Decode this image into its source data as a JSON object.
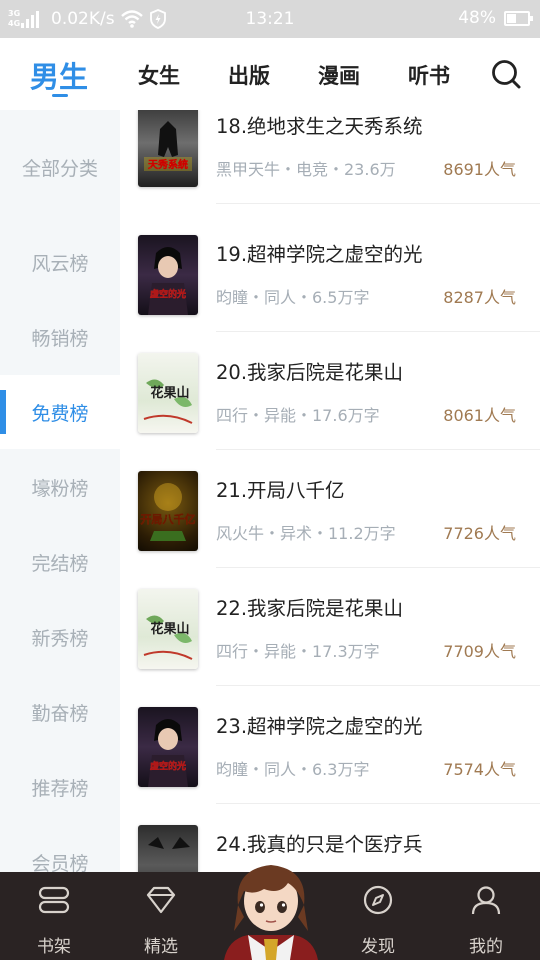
{
  "status_bar": {
    "network_type_a": "3G",
    "network_type_b": "4G",
    "speed": "0.02K/s",
    "time": "13:21",
    "battery": "48%",
    "icons": [
      "signal-icon",
      "wifi-icon",
      "shield-icon",
      "battery-icon"
    ]
  },
  "top_tabs": [
    {
      "label": "男生",
      "active": true
    },
    {
      "label": "女生",
      "active": false
    },
    {
      "label": "出版",
      "active": false
    },
    {
      "label": "漫画",
      "active": false
    },
    {
      "label": "听书",
      "active": false
    }
  ],
  "search_icon": "search-icon",
  "sidebar": {
    "items": [
      {
        "label": "全部分类",
        "active": false
      },
      {
        "label": "风云榜",
        "active": false
      },
      {
        "label": "畅销榜",
        "active": false
      },
      {
        "label": "免费榜",
        "active": true
      },
      {
        "label": "壕粉榜",
        "active": false
      },
      {
        "label": "完结榜",
        "active": false
      },
      {
        "label": "新秀榜",
        "active": false
      },
      {
        "label": "勤奋榜",
        "active": false
      },
      {
        "label": "推荐榜",
        "active": false
      },
      {
        "label": "会员榜",
        "active": false
      }
    ]
  },
  "books": [
    {
      "title": "18.绝地求生之天秀系统",
      "meta": "黑甲天牛・电竞・23.6万",
      "hot": "8691人气",
      "cover_text": "天秀系统"
    },
    {
      "title": "19.超神学院之虚空的光",
      "meta": "昀瞳・同人・6.5万字",
      "hot": "8287人气",
      "cover_text": "虚空的光"
    },
    {
      "title": "20.我家后院是花果山",
      "meta": "四行・异能・17.6万字",
      "hot": "8061人气",
      "cover_text": "花果山"
    },
    {
      "title": "21.开局八千亿",
      "meta": "风火牛・异术・11.2万字",
      "hot": "7726人气",
      "cover_text": "开局八千亿"
    },
    {
      "title": "22.我家后院是花果山",
      "meta": "四行・异能・17.3万字",
      "hot": "7709人气",
      "cover_text": "花果山"
    },
    {
      "title": "23.超神学院之虚空的光",
      "meta": "昀瞳・同人・6.3万字",
      "hot": "7574人气",
      "cover_text": "虚空的光"
    },
    {
      "title": "24.我真的只是个医疗兵",
      "meta": "",
      "hot": "",
      "cover_text": ""
    }
  ],
  "bottom_nav": [
    {
      "label": "书架",
      "icon": "bookshelf-icon"
    },
    {
      "label": "精选",
      "icon": "diamond-icon"
    },
    {
      "label": "发现",
      "icon": "compass-icon"
    },
    {
      "label": "我的",
      "icon": "user-icon"
    }
  ],
  "colors": {
    "accent": "#2f8ee6",
    "popularity": "#a07a52",
    "sidebar_bg": "#f4f7f9",
    "bottom_nav_bg": "#2a2323"
  }
}
